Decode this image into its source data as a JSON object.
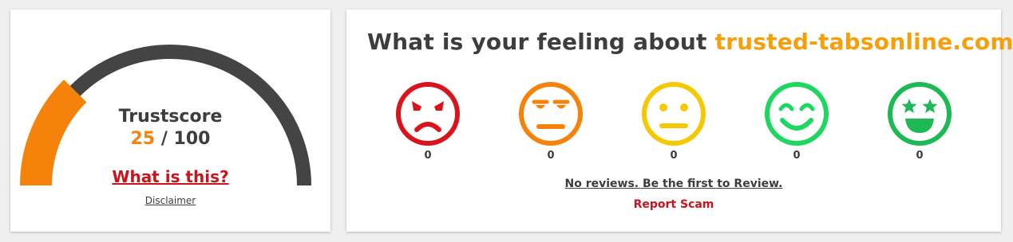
{
  "trust": {
    "title": "Trustscore",
    "score": "25",
    "max": "/ 100",
    "score_fraction": 0.25,
    "what_link": "What is this?",
    "disclaimer": "Disclaimer",
    "colors": {
      "track": "#444444",
      "fill": "#f5820b"
    }
  },
  "feeling": {
    "question_prefix": "What is your feeling about ",
    "domain": "trusted-tabsonline.com",
    "question_suffix": "?",
    "faces": [
      {
        "icon": "angry-face-icon",
        "color": "#d9141c",
        "count": "0"
      },
      {
        "icon": "annoyed-face-icon",
        "color": "#f5820b",
        "count": "0"
      },
      {
        "icon": "neutral-face-icon",
        "color": "#f5c800",
        "count": "0"
      },
      {
        "icon": "smiling-face-icon",
        "color": "#1ed760",
        "count": "0"
      },
      {
        "icon": "star-eyes-face-icon",
        "color": "#1db954",
        "count": "0"
      }
    ],
    "no_reviews": "No reviews. Be the first to Review.",
    "report": "Report Scam"
  }
}
